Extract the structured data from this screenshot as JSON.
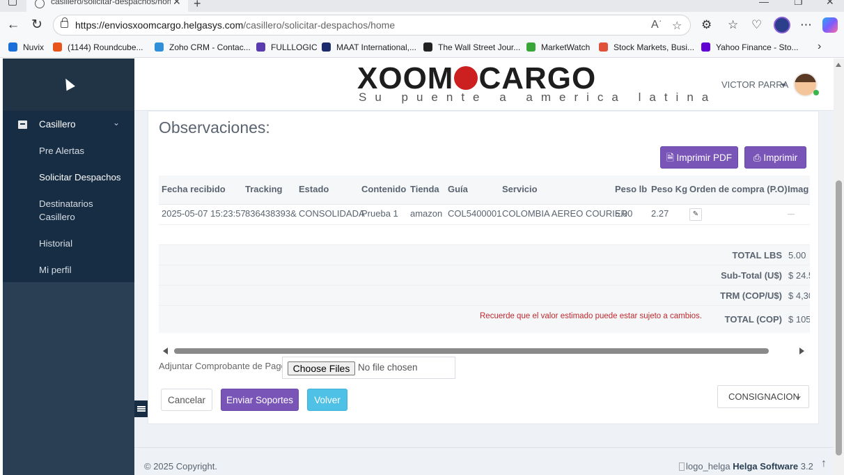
{
  "browser": {
    "tab_title": "casillero/solicitar-despachos/hom",
    "tab_close": "✕",
    "new_tab": "+",
    "url_host": "https://enviosxoomcargo.helgasys.com",
    "url_path": "/casillero/solicitar-despachos/home",
    "bookmarks": [
      {
        "label": "Nuvix",
        "color": "#1b6fd8"
      },
      {
        "label": "(1144) Roundcube...",
        "color": "#e8551b"
      },
      {
        "label": "Zoho CRM - Contac...",
        "color": "#2f8fd8"
      },
      {
        "label": "FULLLOGIC",
        "color": "#5a3bb0"
      },
      {
        "label": "MAAT International,...",
        "color": "#1b2a6b"
      },
      {
        "label": "The Wall Street Jour...",
        "color": "#222222"
      },
      {
        "label": "MarketWatch",
        "color": "#3aa639"
      },
      {
        "label": "Stock Markets, Busi...",
        "color": "#e0513b"
      },
      {
        "label": "Yahoo Finance - Sto...",
        "color": "#6001d2"
      }
    ]
  },
  "sidebar": {
    "group_label": "Casillero",
    "items": [
      {
        "label": "Pre Alertas"
      },
      {
        "label": "Solicitar Despachos"
      },
      {
        "label": "Destinatarios Casillero"
      },
      {
        "label": "Historial"
      },
      {
        "label": "Mi perfil"
      }
    ]
  },
  "header": {
    "logo_left": "XOOM",
    "logo_right": "CARGO",
    "logo_tagline": "Su puente a america latina",
    "user_name": "VICTOR PARRA"
  },
  "panel": {
    "title": "Observaciones:",
    "pdf_button": "Imprimir PDF",
    "print_button": "Imprimir",
    "columns": [
      "Fecha recibido",
      "Tracking",
      "Estado",
      "Contenido",
      "Tienda",
      "Guía",
      "Servicio",
      "Peso lb",
      "Peso Kg",
      "Orden de compra (P.O)",
      "Imag"
    ],
    "rows": [
      {
        "fecha": "2025-05-07 15:23:57",
        "tracking": "836438393&",
        "estado": "CONSOLIDADA",
        "contenido": "Prueba 1",
        "tienda": "amazon",
        "guia": "COL5400001",
        "servicio": "COLOMBIA AEREO COURIER",
        "peso_lb": "5.00",
        "peso_kg": "2.27"
      }
    ],
    "summary": {
      "total_lbs_label": "TOTAL LBS",
      "total_lbs_value": "5.00",
      "subtotal_label": "Sub-Total (U$)",
      "subtotal_value": "$ 24.5",
      "trm_label": "TRM (COP/U$)",
      "trm_value": "$ 4,30",
      "notice": "Recuerde que el valor estimado puede estar sujeto a cambios.",
      "total_cop_label": "TOTAL (COP)",
      "total_cop_value": "$ 105,"
    },
    "attach_label": "Adjuntar Comprobante de Pago",
    "file_button": "Choose Files",
    "file_status": "No file chosen",
    "cancel_button": "Cancelar",
    "send_button": "Enviar Soportes",
    "back_button": "Volver",
    "select_value": "CONSIGNACION"
  },
  "footer": {
    "copyright": "© 2025 Copyright.",
    "logo_alt": "logo_helga",
    "brand": "Helga Software",
    "version": "3.2"
  }
}
